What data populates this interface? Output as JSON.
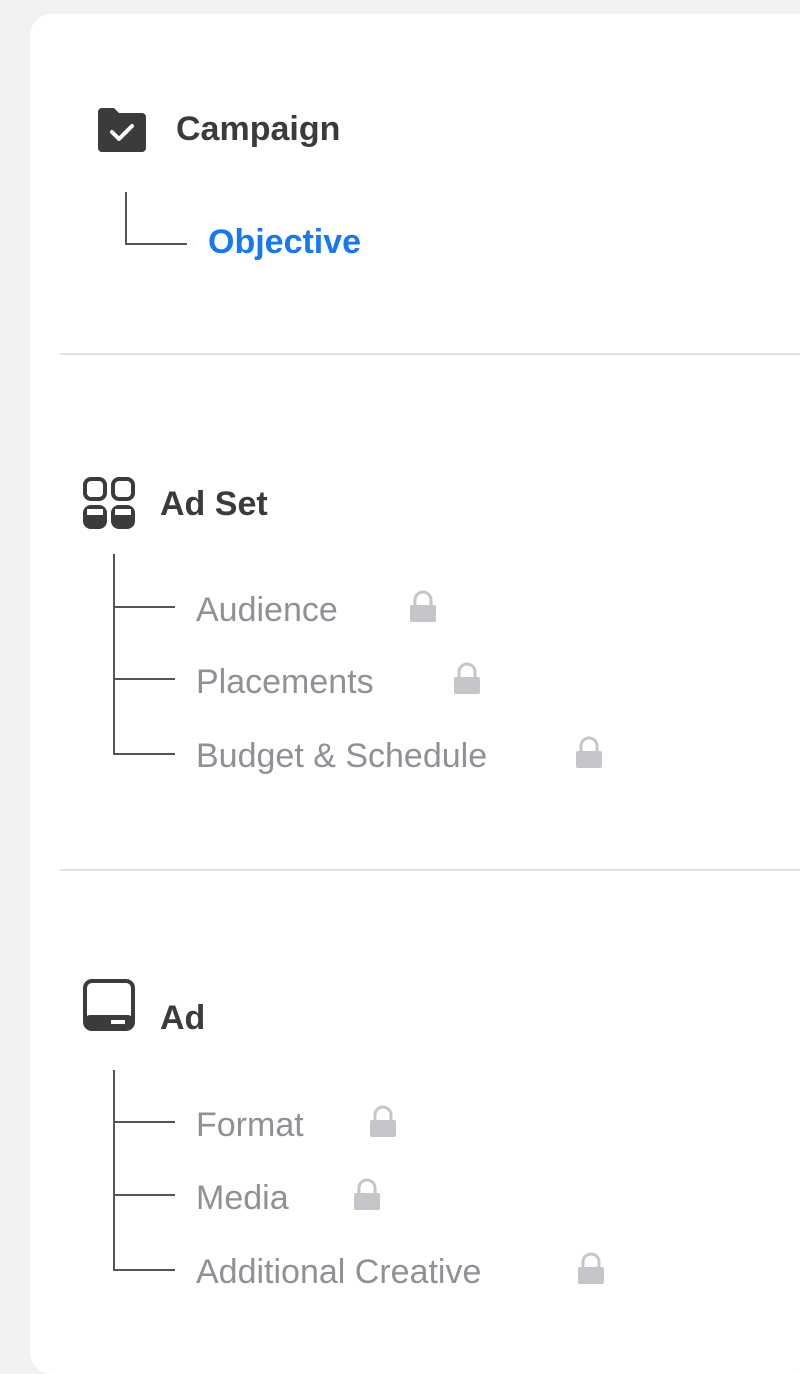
{
  "colors": {
    "page_bg": "#f2f2f2",
    "panel_bg": "#ffffff",
    "active": "#1877f2",
    "heading": "#3a3b3d",
    "disabled": "#8f9196",
    "lock": "#c5c6c9"
  },
  "sections": {
    "campaign": {
      "icon": "folder-check-icon",
      "title": "Campaign",
      "items": [
        {
          "label": "Objective",
          "state": "active",
          "locked": false
        }
      ]
    },
    "ad_set": {
      "icon": "grid-icon",
      "title": "Ad Set",
      "items": [
        {
          "label": "Audience",
          "state": "locked",
          "locked": true
        },
        {
          "label": "Placements",
          "state": "locked",
          "locked": true
        },
        {
          "label": "Budget & Schedule",
          "state": "locked",
          "locked": true
        }
      ]
    },
    "ad": {
      "icon": "ad-screen-icon",
      "title": "Ad",
      "items": [
        {
          "label": "Format",
          "state": "locked",
          "locked": true
        },
        {
          "label": "Media",
          "state": "locked",
          "locked": true
        },
        {
          "label": "Additional Creative",
          "state": "locked",
          "locked": true
        }
      ]
    }
  }
}
